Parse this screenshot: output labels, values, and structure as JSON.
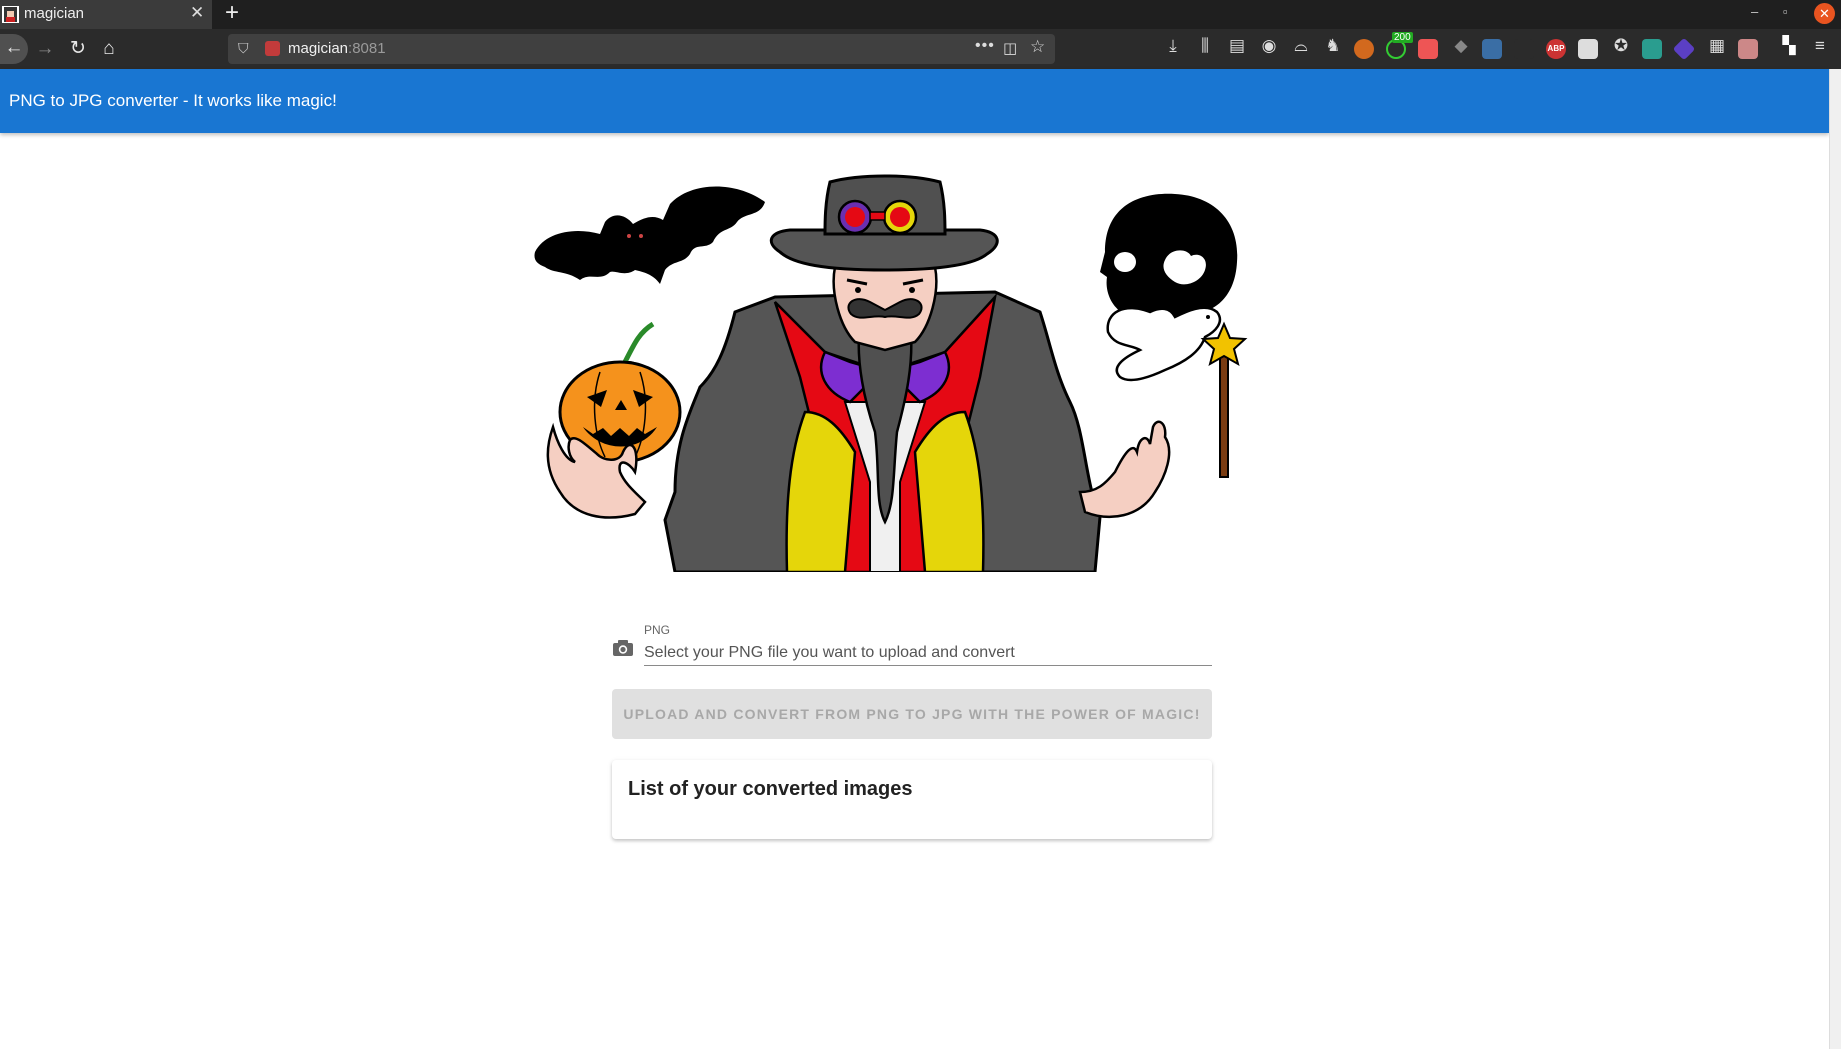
{
  "browser": {
    "tab_title": "magician",
    "url_host": "magician",
    "url_port": ":8081",
    "url_more": "•••",
    "badge_count": "200",
    "adblock_label": "ABP"
  },
  "app": {
    "title": "PNG to JPG converter - It works like magic!",
    "accent_color": "#1976d2"
  },
  "form": {
    "field_label": "PNG",
    "field_placeholder": "Select your PNG file you want to upload and convert",
    "field_value": "",
    "submit_label": "Upload and convert from PNG to JPG with the power of magic!",
    "submit_disabled": true
  },
  "results": {
    "title": "List of your converted images",
    "items": []
  },
  "illustration": {
    "subjects": [
      "bat-icon",
      "magician-figure",
      "skull-icon",
      "pumpkin-icon",
      "dove-icon",
      "magic-wand-icon"
    ]
  }
}
